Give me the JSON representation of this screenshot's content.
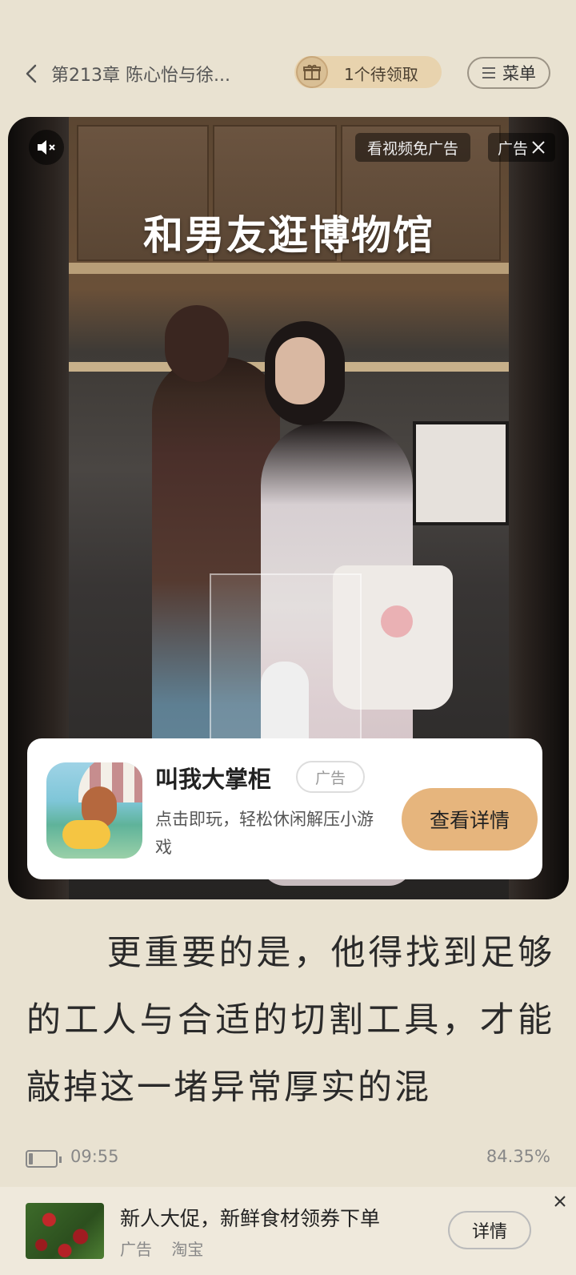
{
  "header": {
    "chapter_title": "第213章 陈心怡与徐...",
    "gift_label": "1个待领取",
    "menu_label": "菜单"
  },
  "ad_video": {
    "title": "和男友逛博物馆",
    "skip_label": "看视频免广告",
    "close_label": "广告"
  },
  "app_card": {
    "name": "叫我大掌柜",
    "badge": "广告",
    "desc": "点击即玩，轻松休闲解压小游戏",
    "button": "查看详情"
  },
  "reading": {
    "text": "更重要的是，他得找到足够的工人与合适的切割工具，才能敲掉这一堵异常厚实的混"
  },
  "status": {
    "time": "09:55",
    "progress": "84.35%",
    "battery_level": 0.15
  },
  "banner": {
    "title": "新人大促，新鲜食材领券下单",
    "ad_label": "广告",
    "source": "淘宝",
    "button": "详情"
  },
  "colors": {
    "background": "#e9e2d1",
    "accent_button": "#e6b57d",
    "gift_pill": "#e8d3ae"
  }
}
